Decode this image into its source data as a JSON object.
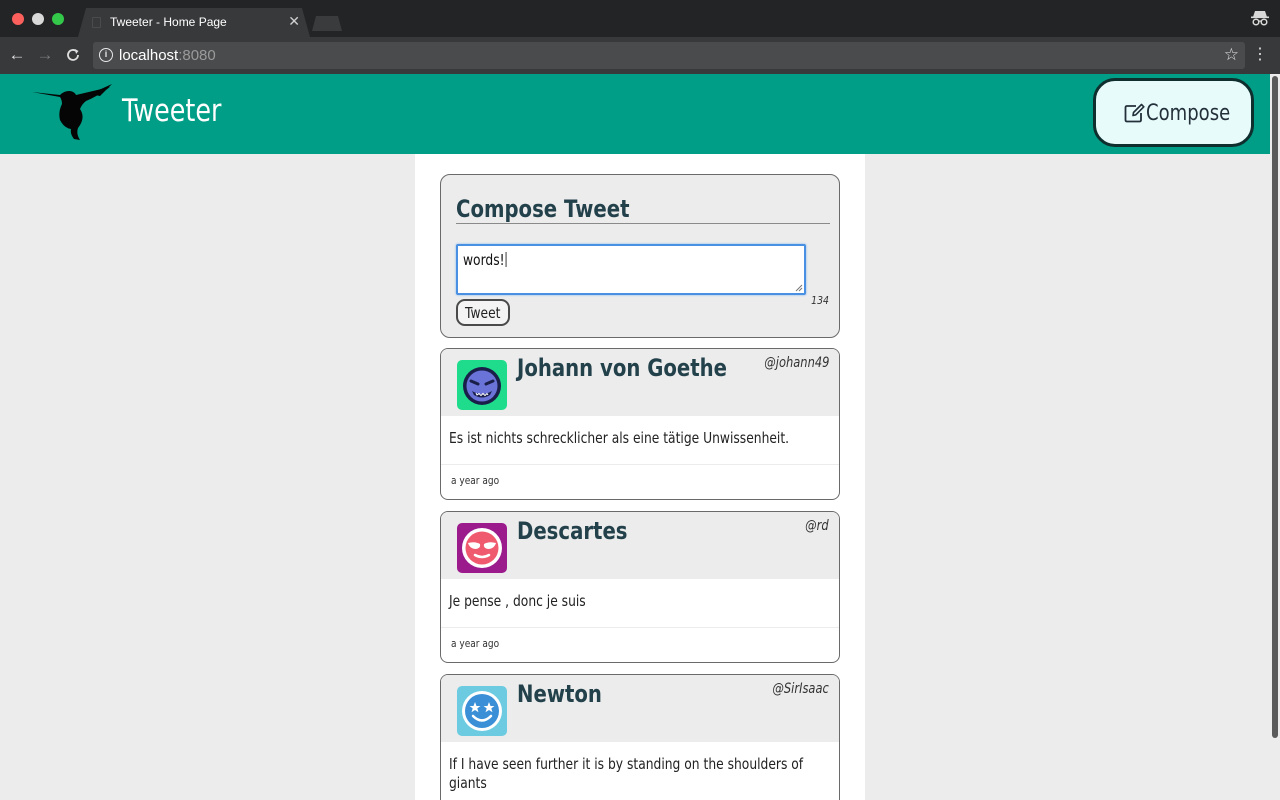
{
  "browser": {
    "tab_title": "Tweeter - Home Page",
    "url_host": "localhost",
    "url_port": ":8080",
    "close_glyph": "✕"
  },
  "header": {
    "brand": "Tweeter",
    "compose_label": "Compose",
    "brand_color": "#009e86"
  },
  "compose": {
    "title": "Compose Tweet",
    "textarea_value": "words!",
    "tweet_button": "Tweet",
    "char_counter": "134"
  },
  "tweets": [
    {
      "name": "Johann von Goethe",
      "handle": "@johann49",
      "text": "Es ist nichts schrecklicher als eine tätige Unwissenheit.",
      "time": "a year ago",
      "avatar_icon": "devil-face-icon",
      "avatar_color": "#1edc8c"
    },
    {
      "name": "Descartes",
      "handle": "@rd",
      "text": "Je pense , donc je suis",
      "time": "a year ago",
      "avatar_icon": "sunglasses-face-icon",
      "avatar_color": "#9b1a8c"
    },
    {
      "name": "Newton",
      "handle": "@SirIsaac",
      "text": "If I have seen further it is by standing on the shoulders of giants",
      "time": "",
      "avatar_icon": "star-eyes-face-icon",
      "avatar_color": "#6ccbe0"
    }
  ]
}
